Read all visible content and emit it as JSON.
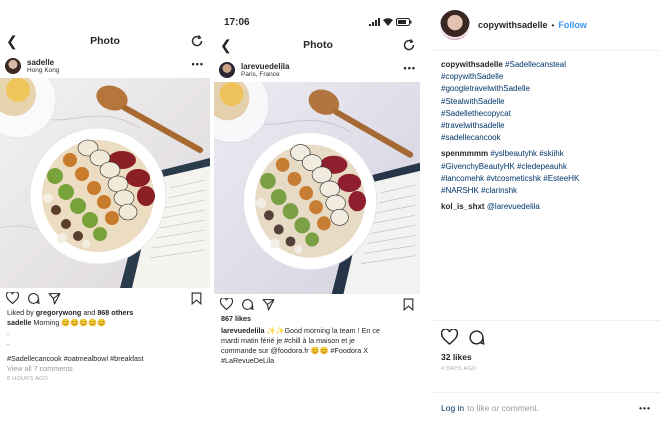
{
  "panel1": {
    "nav": {
      "title": "Photo"
    },
    "post": {
      "username": "sadelle",
      "location": "Hong Kong"
    },
    "likes": {
      "prefix": "Liked by",
      "user": "gregorywong",
      "mid": "and",
      "others": "868 others"
    },
    "caption": {
      "username": "sadelle",
      "text": "Morning",
      "emojis": "😊😊😊😊😊"
    },
    "dots": [
      ".",
      "."
    ],
    "hashtags": "#Sadellecancook #oatmealbowl #breakfast",
    "view_comments": "View all 7 comments",
    "time": "8 HOURS AGO"
  },
  "panel2": {
    "status": {
      "time": "17:06"
    },
    "nav": {
      "title": "Photo"
    },
    "post": {
      "username": "larevuedelila",
      "location": "Paris, France"
    },
    "likes": "867 likes",
    "caption": {
      "username": "larevuedelila",
      "line1": "✨✨Good morning la team ! En ce",
      "line2": "mardi matin férié je #chill à la maison et je",
      "line3": "commande sur @foodora.fr 😊😊 #Foodora X",
      "line4": "#LaRevueDeLila"
    }
  },
  "panel3": {
    "header": {
      "username": "copywithsadelle",
      "sep": "•",
      "follow": "Follow"
    },
    "comment1": {
      "username": "copywithsadelle",
      "tags": [
        "#Sadellecansteal",
        "#copywithSadelle",
        "#googletravelwithSadelle",
        "#StealwithSadelle",
        "#Sadellethecopycat",
        "#travelwithsadelle",
        "#sadellecancook"
      ]
    },
    "comment2": {
      "username": "spenmmmm",
      "lines": [
        "#yslbeautyhk #skiihk",
        "#GivenchyBeautyHK #cledepeauhk",
        "#lancomehk #vtcosmeticshk #EsteeHK",
        "#NARSHK #clarinshk"
      ]
    },
    "comment3": {
      "username": "kol_is_shxt",
      "mention": "@larevuedelila"
    },
    "likes": "32 likes",
    "time": "4 DAYS AGO",
    "login": {
      "link": "Log in",
      "rest": "to like or comment.",
      "more": "•••"
    }
  },
  "colors": {
    "text": "#262626",
    "link": "#003569",
    "follow": "#3897f0",
    "muted": "#999999"
  }
}
